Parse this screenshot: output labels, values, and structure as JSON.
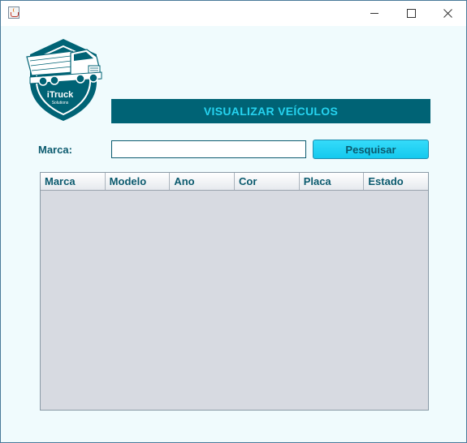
{
  "window": {
    "icon": "java-icon",
    "controls": [
      "minimize-icon",
      "maximize-icon",
      "close-icon"
    ]
  },
  "logo": {
    "brand": "iTruck",
    "tagline": "Solutions",
    "icon": "truck-icon",
    "colors": {
      "shield": "#006375",
      "inner": "#ffffff"
    }
  },
  "header": {
    "title": "VISUALIZAR VEÍCULOS"
  },
  "search": {
    "label": "Marca:",
    "value": "",
    "button_label": "Pesquisar"
  },
  "table": {
    "columns": [
      "Marca",
      "Modelo",
      "Ano",
      "Cor",
      "Placa",
      "Estado"
    ],
    "rows": []
  },
  "colors": {
    "accent": "#006375",
    "accent_text": "#25d3f0",
    "button": "#1ccdf0",
    "label": "#0b5a6e",
    "background": "#f0fbfd",
    "table_background": "#d7dae1"
  }
}
